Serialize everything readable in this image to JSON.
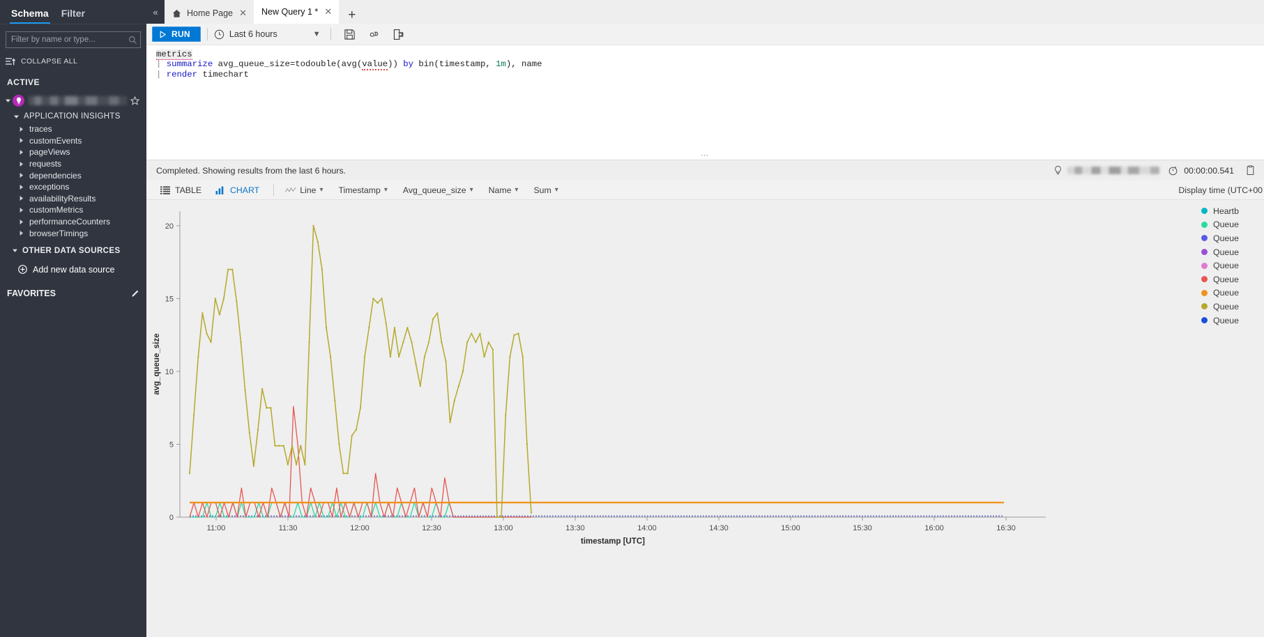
{
  "sidebar": {
    "tabs": [
      {
        "label": "Schema",
        "active": true
      },
      {
        "label": "Filter",
        "active": false
      }
    ],
    "filter_placeholder": "Filter by name or type...",
    "collapse_all": "COLLAPSE ALL",
    "active_header": "ACTIVE",
    "resource_name_redacted": "",
    "group_label": "APPLICATION INSIGHTS",
    "tables": [
      "traces",
      "customEvents",
      "pageViews",
      "requests",
      "dependencies",
      "exceptions",
      "availabilityResults",
      "customMetrics",
      "performanceCounters",
      "browserTimings"
    ],
    "other_data_sources": "OTHER DATA SOURCES",
    "add_new_data_source": "Add new data source",
    "favorites": "FAVORITES"
  },
  "tabs": [
    {
      "label": "Home Page",
      "active": false,
      "icon": "home-icon"
    },
    {
      "label": "New Query 1 *",
      "active": true,
      "icon": ""
    }
  ],
  "toolbar": {
    "run_label": "RUN",
    "time_range": "Last 6 hours",
    "icons": [
      "save-icon",
      "link-icon",
      "export-icon"
    ]
  },
  "query": {
    "line1": "metrics",
    "line2_pipe": "|",
    "line2_kw": "summarize",
    "line2_rest_a": " avg_queue_size=todouble(avg(",
    "line2_value": "value",
    "line2_rest_b": ")) ",
    "line2_by": "by",
    "line2_rest_c": " bin(timestamp, ",
    "line2_1m": "1m",
    "line2_rest_d": "), name",
    "line3_pipe": "|",
    "line3_kw": "render",
    "line3_rest": " timechart"
  },
  "results": {
    "status": "Completed. Showing results from the last 6 hours.",
    "duration": "00:00:00.541"
  },
  "chart_toolbar": {
    "table": "TABLE",
    "chart": "CHART",
    "visual": "Line",
    "x_axis": "Timestamp",
    "y_axis": "Avg_queue_size",
    "split_by": "Name",
    "aggregation": "Sum",
    "display_time": "Display time (UTC+00"
  },
  "chart_data": {
    "type": "line",
    "title": "",
    "xlabel": "timestamp [UTC]",
    "ylabel": "avg_queue_size",
    "ylim": [
      0,
      21
    ],
    "yticks": [
      0,
      5,
      10,
      15,
      20
    ],
    "xticks": [
      "11:00",
      "11:30",
      "12:00",
      "12:30",
      "13:00",
      "13:30",
      "14:00",
      "14:30",
      "15:00",
      "15:30",
      "16:00",
      "16:30"
    ],
    "grid": false,
    "legend_position": "right",
    "series": [
      {
        "name": "Heartb",
        "color": "#00b7c3",
        "values": [
          0,
          0,
          0,
          0,
          0,
          0,
          0,
          0,
          0,
          0,
          0,
          0,
          0,
          0,
          0,
          0,
          0,
          0,
          0,
          0,
          0,
          0,
          0,
          0,
          0,
          0,
          0,
          0,
          0,
          0,
          0,
          0,
          0,
          0,
          0,
          0,
          0,
          0,
          0,
          0,
          0,
          0,
          0,
          0,
          0,
          0,
          0,
          0,
          0,
          0,
          0,
          0,
          0,
          0,
          0,
          0,
          0,
          0,
          0,
          0,
          0,
          0,
          0,
          0,
          0,
          0,
          0,
          0,
          0,
          0,
          0,
          0,
          0,
          0,
          0,
          0,
          0,
          0,
          0,
          0
        ]
      },
      {
        "name": "Queue",
        "color": "#2bd99f",
        "values": [
          0,
          0,
          0,
          0,
          1,
          0,
          0,
          1,
          0,
          0,
          1,
          0,
          1,
          0,
          0,
          0,
          1,
          0,
          0,
          1,
          1,
          0,
          1,
          0,
          0,
          1,
          0,
          0,
          1,
          0,
          1,
          0,
          0,
          1,
          0,
          1,
          0,
          0,
          1,
          0,
          0,
          1,
          0,
          1,
          0,
          0,
          1,
          0,
          0,
          1,
          0,
          0,
          1,
          0,
          1,
          0,
          0,
          1,
          0,
          0,
          1,
          0,
          0,
          0,
          0,
          0,
          0,
          0,
          0,
          0,
          0,
          0,
          0,
          0,
          0,
          0,
          0,
          0,
          0,
          0
        ]
      },
      {
        "name": "Queue",
        "color": "#5a5ae6",
        "values": []
      },
      {
        "name": "Queue",
        "color": "#9b4fd8",
        "values": []
      },
      {
        "name": "Queue",
        "color": "#e07ad0",
        "values": []
      },
      {
        "name": "Queue",
        "color": "#e8554f",
        "values": [
          0,
          1,
          0,
          1,
          0,
          1,
          1,
          0,
          1,
          0,
          1,
          0,
          2,
          0,
          1,
          1,
          0,
          1,
          0,
          2,
          1,
          0,
          1,
          0,
          7.6,
          5,
          1,
          0,
          2,
          1,
          0,
          1,
          1,
          0,
          2,
          0,
          1,
          0,
          1,
          0,
          1,
          1,
          0,
          3,
          1,
          0,
          1,
          0,
          2,
          1,
          0,
          1,
          2,
          0,
          1,
          0,
          2,
          1,
          0,
          2.7,
          1,
          0,
          0,
          0,
          0,
          0,
          0,
          0,
          0,
          0,
          0,
          0,
          0,
          0,
          0,
          0,
          0,
          0,
          0,
          0
        ]
      },
      {
        "name": "Queue",
        "color": "#f0921e",
        "values": [
          1,
          1,
          1,
          1,
          1,
          1,
          1,
          1,
          1,
          1,
          1,
          1,
          1,
          1,
          1,
          1,
          1,
          1,
          1,
          1,
          1,
          1,
          1,
          1,
          1,
          1,
          1,
          1,
          1,
          1,
          1,
          1,
          1,
          1,
          1,
          1,
          1,
          1,
          1,
          1,
          1,
          1,
          1,
          1,
          1,
          1,
          1,
          1,
          1,
          1,
          1,
          1,
          1,
          1,
          1,
          1,
          1,
          1,
          1,
          1,
          1,
          1,
          1,
          1,
          1,
          1,
          1,
          1,
          1,
          1,
          1,
          1,
          1,
          1,
          1,
          1,
          1,
          1,
          1,
          1
        ]
      },
      {
        "name": "Queue",
        "color": "#b5a92b",
        "values": [
          3,
          7,
          11,
          14,
          12.6,
          12,
          15,
          13.9,
          15,
          17,
          17,
          14.8,
          12,
          8.7,
          5.8,
          3.5,
          6,
          8.8,
          7.5,
          7.5,
          4.9,
          4.9,
          4.9,
          3.6,
          4.9,
          3.6,
          4.9,
          3.6,
          12,
          20,
          18.9,
          17,
          13,
          11,
          8,
          5,
          3,
          3,
          5.6,
          6,
          7.5,
          11,
          13,
          15,
          14.7,
          15,
          13.3,
          11,
          13,
          11,
          12,
          13,
          12,
          10.5,
          9,
          11,
          12,
          13.6,
          14,
          12,
          10.7,
          6.5,
          8,
          9,
          10,
          12,
          12.6,
          12,
          12.6,
          11,
          12,
          11.5,
          0,
          0,
          7,
          11,
          12.5,
          12.6,
          11,
          5,
          0.3
        ]
      },
      {
        "name": "Queue",
        "color": "#1d4fd8",
        "values": []
      }
    ]
  }
}
